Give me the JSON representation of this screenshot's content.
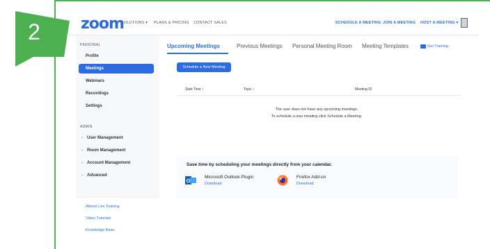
{
  "step": {
    "number": "2"
  },
  "header": {
    "logo": "zoom",
    "nav": [
      "SOLUTIONS ▾",
      "PLANS & PRICING",
      "CONTACT SALES"
    ],
    "actions": [
      "SCHEDULE A MEETING",
      "JOIN A MEETING",
      "HOST A MEETING ▾"
    ]
  },
  "sidebar": {
    "personal_label": "PERSONAL",
    "personal_items": [
      "Profile",
      "Meetings",
      "Webinars",
      "Recordings",
      "Settings"
    ],
    "admin_label": "ADMIN",
    "admin_items": [
      "User Management",
      "Room Management",
      "Account Management",
      "Advanced"
    ],
    "links": [
      "Attend Live Training",
      "Video Tutorials",
      "Knowledge Base"
    ]
  },
  "main": {
    "tabs": [
      "Upcoming Meetings",
      "Previous Meetings",
      "Personal Meeting Room",
      "Meeting Templates"
    ],
    "get_training": "Get Training",
    "schedule_button": "Schedule a New Meeting",
    "columns": [
      "Start Time ↕",
      "Topic ↕",
      "Meeting ID"
    ],
    "empty_line1": "The user does not have any upcoming meetings.",
    "empty_line2": "To schedule a new meeting click Schedule a Meeting.",
    "promo": {
      "title": "Save time by scheduling your meetings directly from your calendar.",
      "plugins": [
        {
          "name": "Microsoft Outlook Plugin",
          "link": "Download"
        },
        {
          "name": "Firefox Add-on",
          "link": "Download"
        }
      ]
    }
  },
  "colors": {
    "accent": "#2d6cdf",
    "frame": "#4caf50"
  }
}
